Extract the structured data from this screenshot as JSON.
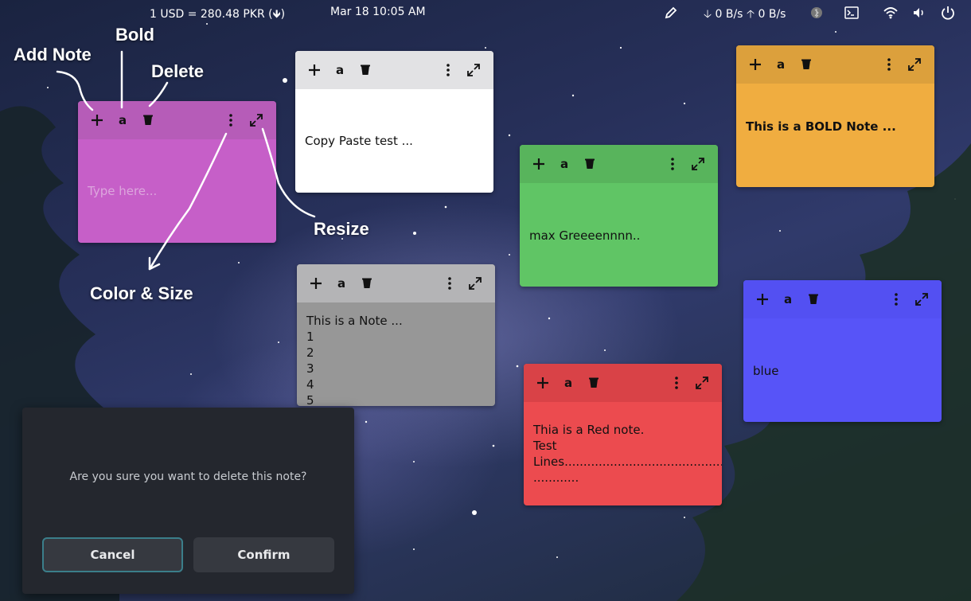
{
  "topbar": {
    "currency": "1 USD = 280.48 PKR (🡻)",
    "datetime": "Mar 18  10:05 AM",
    "net_down": "🡣 0 B/s",
    "net_up": "🡡 0 B/s",
    "icons": [
      "pencil-icon",
      "bluetooth-icon",
      "terminal-icon",
      "wifi-icon",
      "volume-icon",
      "power-icon"
    ]
  },
  "annotations": {
    "add_note": "Add Note",
    "bold": "Bold",
    "delete": "Delete",
    "resize": "Resize",
    "color_size": "Color & Size"
  },
  "notes": [
    {
      "id": "purple",
      "header_color": "#b65cb8",
      "body_color": "#c65fc8",
      "placeholder": "Type here...",
      "text": ""
    },
    {
      "id": "white",
      "header_color": "#e2e2e4",
      "body_color": "#ffffff",
      "text": "Copy Paste test ..."
    },
    {
      "id": "gray",
      "header_color": "#b4b4b6",
      "body_color": "#979797",
      "text": "This is a Note ...\n1\n2\n3\n4\n5"
    },
    {
      "id": "green",
      "header_color": "#58b45c",
      "body_color": "#60c565",
      "text": "max Greeeennnn.."
    },
    {
      "id": "red",
      "header_color": "#d94247",
      "body_color": "#ec4b4f",
      "text": "Thia is a Red note.\nTest\nLines...................................................\n............"
    },
    {
      "id": "orange",
      "header_color": "#dca03c",
      "body_color": "#f0ad40",
      "text": "This is a BOLD  Note ..."
    },
    {
      "id": "blue",
      "header_color": "#5350f2",
      "body_color": "#5754f8",
      "text": "blue"
    }
  ],
  "dialog": {
    "message": "Are you sure you want to delete this note?",
    "cancel_label": "Cancel",
    "confirm_label": "Confirm"
  }
}
